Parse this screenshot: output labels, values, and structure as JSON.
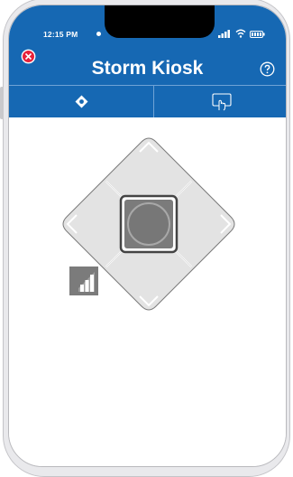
{
  "status_bar": {
    "time": "12:15 PM",
    "icons": [
      "signal-icon",
      "wifi-icon",
      "battery-icon"
    ]
  },
  "header": {
    "title": "Storm Kiosk",
    "close_icon": "close-icon",
    "help_icon": "help-icon"
  },
  "tabs": [
    {
      "icon": "dpad-icon",
      "selected": true
    },
    {
      "icon": "touch-screen-icon",
      "selected": false
    }
  ],
  "controls": {
    "dpad_icon": "dpad-control",
    "center_icon": "select-circle-icon",
    "indicator_icon": "signal-strength-icon"
  },
  "colors": {
    "brand": "#1668b3",
    "close": "#e8213a",
    "dpad_fill": "#e3e3e3",
    "center_fill": "#7b7b7b"
  }
}
